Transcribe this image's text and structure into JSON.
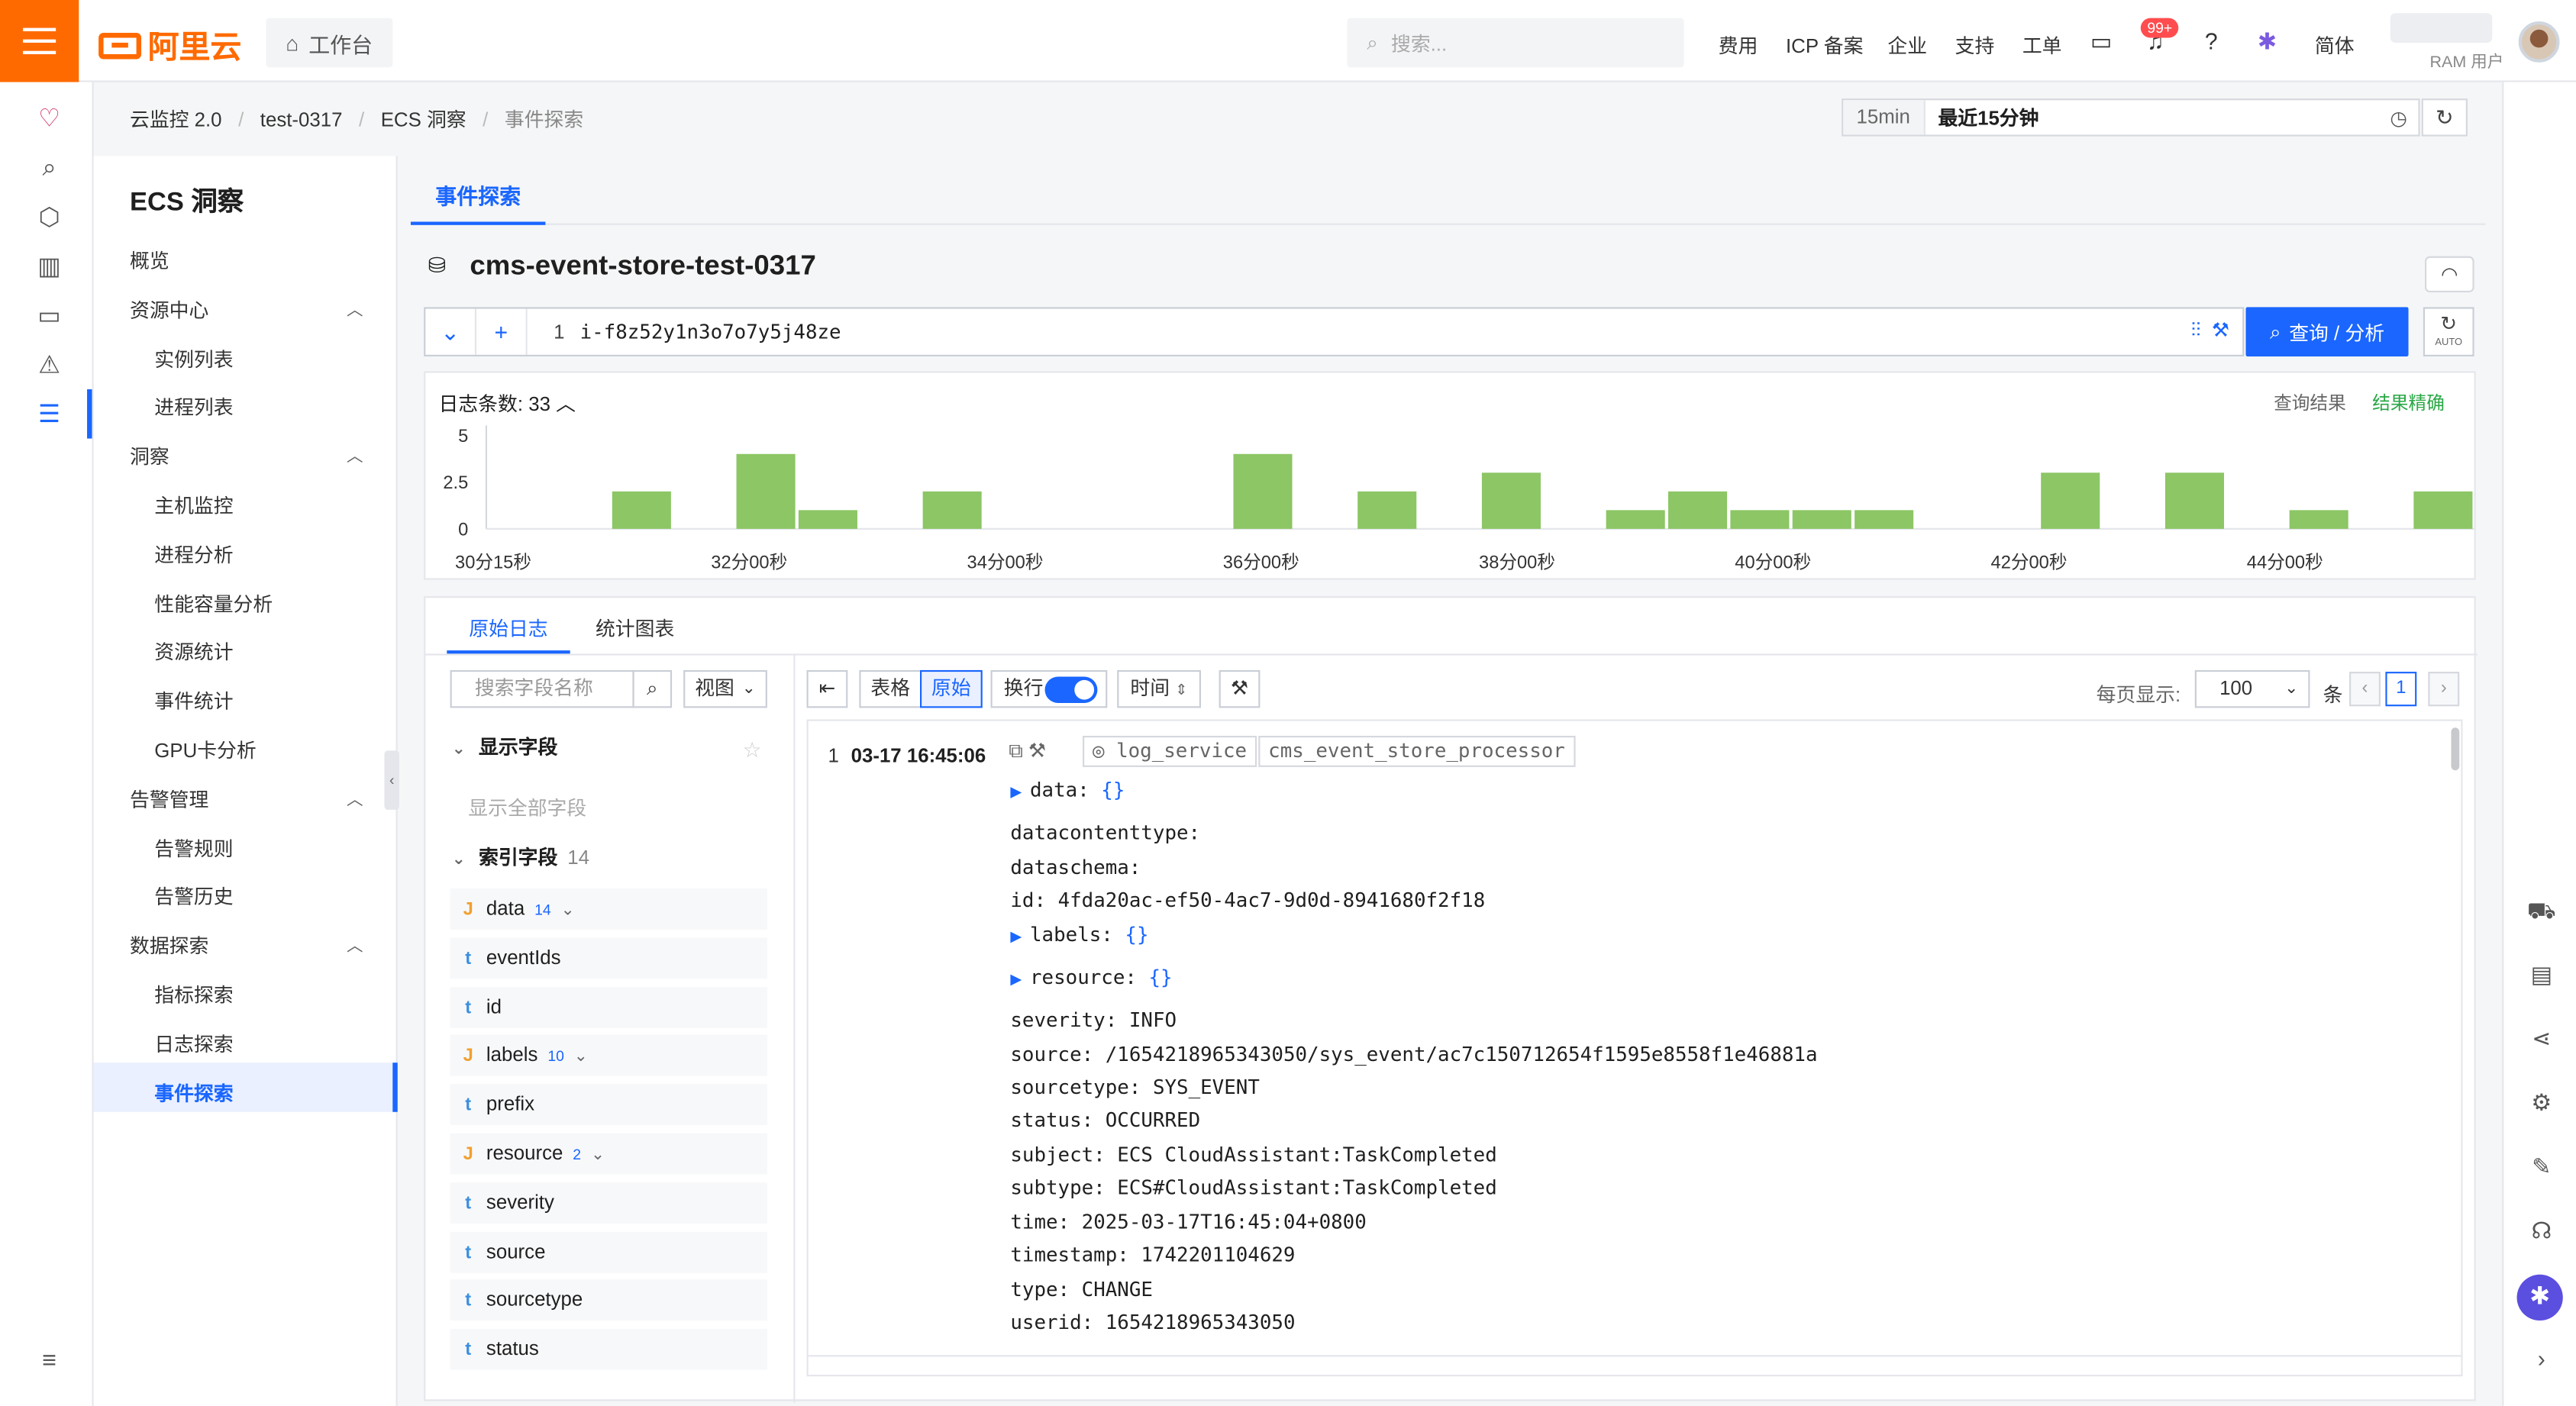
{
  "topnav": {
    "logo_text": "阿里云",
    "workbench": "工作台",
    "search_placeholder": "搜索...",
    "links": [
      "费用",
      "ICP 备案",
      "企业",
      "支持",
      "工单"
    ],
    "notification_badge": "99+",
    "lang": "简体",
    "ram_user": "RAM 用户",
    "brand_color": "#ff6a00"
  },
  "breadcrumb": [
    "云监控 2.0",
    "test-0317",
    "ECS 洞察",
    "事件探索"
  ],
  "time": {
    "tag": "15min",
    "label": "最近15分钟"
  },
  "menu": {
    "title": "ECS 洞察",
    "items": [
      {
        "label": "概览",
        "level": 0
      },
      {
        "label": "资源中心",
        "level": 0,
        "expanded": true
      },
      {
        "label": "实例列表",
        "level": 1
      },
      {
        "label": "进程列表",
        "level": 1
      },
      {
        "label": "洞察",
        "level": 0,
        "expanded": true
      },
      {
        "label": "主机监控",
        "level": 1
      },
      {
        "label": "进程分析",
        "level": 1
      },
      {
        "label": "性能容量分析",
        "level": 1
      },
      {
        "label": "资源统计",
        "level": 1
      },
      {
        "label": "事件统计",
        "level": 1
      },
      {
        "label": "GPU卡分析",
        "level": 1
      },
      {
        "label": "告警管理",
        "level": 0,
        "expanded": true
      },
      {
        "label": "告警规则",
        "level": 1
      },
      {
        "label": "告警历史",
        "level": 1
      },
      {
        "label": "数据探索",
        "level": 0,
        "expanded": true
      },
      {
        "label": "指标探索",
        "level": 1
      },
      {
        "label": "日志探索",
        "level": 1
      },
      {
        "label": "事件探索",
        "level": 1,
        "active": true
      }
    ]
  },
  "main": {
    "tab": "事件探索",
    "store_name": "cms-event-store-test-0317",
    "query": {
      "line": "1",
      "text": "i-f8z52y1n3o7o7y5j48ze",
      "button": "查询 / 分析",
      "auto": "AUTO"
    },
    "histogram": {
      "count_label": "日志条数:",
      "count": "33",
      "result_label": "查询结果",
      "accuracy": "结果精确",
      "accuracy_color": "#2aa745"
    },
    "lower_tabs": [
      "原始日志",
      "统计图表"
    ],
    "field_search_placeholder": "搜索字段名称",
    "view_select": "视图",
    "display_fields": "显示字段",
    "show_all_fields": "显示全部字段",
    "index_fields": "索引字段",
    "index_count": "14",
    "fields": [
      {
        "type": "J",
        "name": "data",
        "count": "14"
      },
      {
        "type": "t",
        "name": "eventIds"
      },
      {
        "type": "t",
        "name": "id"
      },
      {
        "type": "J",
        "name": "labels",
        "count": "10"
      },
      {
        "type": "t",
        "name": "prefix"
      },
      {
        "type": "J",
        "name": "resource",
        "count": "2"
      },
      {
        "type": "t",
        "name": "severity"
      },
      {
        "type": "t",
        "name": "source"
      },
      {
        "type": "t",
        "name": "sourcetype"
      },
      {
        "type": "t",
        "name": "status"
      }
    ],
    "toolbar": {
      "table": "表格",
      "raw": "原始",
      "wrap": "换行",
      "time": "时间",
      "per_page": "每页显示:",
      "page_size": "100",
      "unit": "条",
      "page": "1"
    },
    "log": {
      "index": "1",
      "time": "03-17 16:45:06",
      "tags": [
        "log_service",
        "cms_event_store_processor"
      ],
      "lines": [
        {
          "key": "data:",
          "value": "{}",
          "collapsible": true
        },
        {
          "key": "datacontenttype:",
          "value": ""
        },
        {
          "key": "dataschema:",
          "value": ""
        },
        {
          "key": "id:",
          "value": "4fda20ac-ef50-4ac7-9d0d-8941680f2f18"
        },
        {
          "key": "labels:",
          "value": "{}",
          "collapsible": true
        },
        {
          "key": "resource:",
          "value": "{}",
          "collapsible": true
        },
        {
          "key": "severity:",
          "value": "INFO"
        },
        {
          "key": "source:",
          "value": "/1654218965343050/sys_event/ac7c150712654f1595e8558f1e46881a"
        },
        {
          "key": "sourcetype:",
          "value": "SYS_EVENT"
        },
        {
          "key": "status:",
          "value": "OCCURRED"
        },
        {
          "key": "subject:",
          "value": "ECS CloudAssistant:TaskCompleted"
        },
        {
          "key": "subtype:",
          "value": "ECS#CloudAssistant:TaskCompleted"
        },
        {
          "key": "time:",
          "value": "2025-03-17T16:45:04+0800"
        },
        {
          "key": "timestamp:",
          "value": "1742201104629"
        },
        {
          "key": "type:",
          "value": "CHANGE"
        },
        {
          "key": "userid:",
          "value": "1654218965343050"
        }
      ]
    }
  },
  "chart_data": {
    "type": "bar",
    "title": "",
    "xlabel": "",
    "ylabel": "",
    "ylim": [
      0,
      5
    ],
    "y_ticks": [
      "5",
      "2.5",
      "0"
    ],
    "x_tick_labels": [
      "30分15秒",
      "32分00秒",
      "34分00秒",
      "36分00秒",
      "38分00秒",
      "40分00秒",
      "42分00秒",
      "44分00秒"
    ],
    "bar_color": "#8cc665",
    "values": [
      0,
      0,
      2,
      0,
      4,
      1,
      0,
      2,
      0,
      0,
      0,
      0,
      4,
      0,
      2,
      0,
      3,
      0,
      1,
      2,
      1,
      1,
      1,
      0,
      0,
      3,
      0,
      3,
      0,
      1,
      0,
      2
    ]
  }
}
